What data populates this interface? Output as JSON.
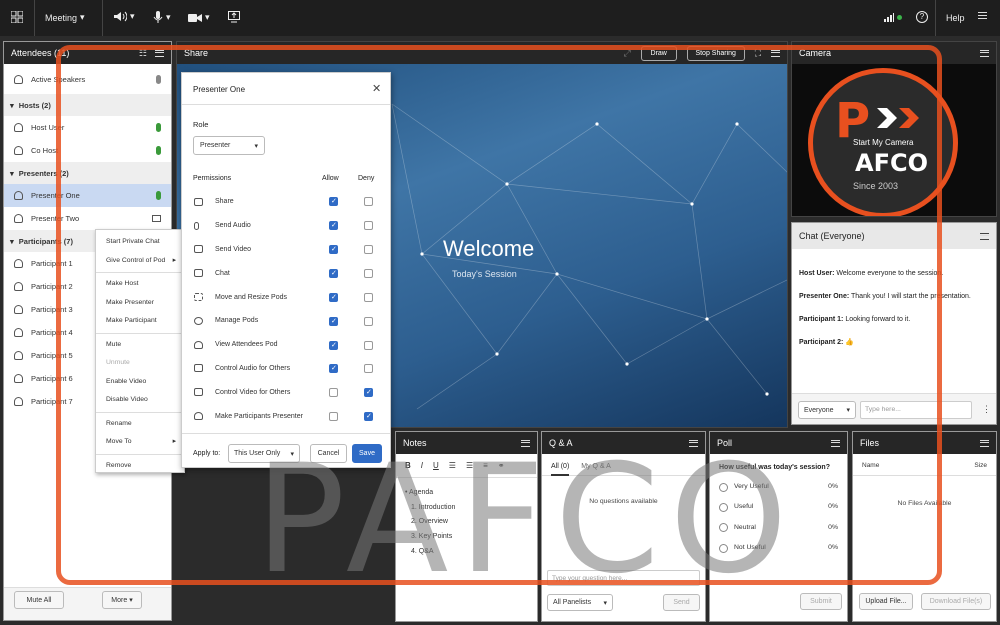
{
  "topbar": {
    "meeting": "Meeting",
    "help": "Help"
  },
  "attendees": {
    "title": "Attendees",
    "count": "(11)",
    "active_speakers": "Active Speakers",
    "hosts_header": "Hosts (2)",
    "hosts": [
      "Host User",
      "Co Host"
    ],
    "presenters_header": "Presenters (2)",
    "presenters": [
      "Presenter One",
      "Presenter Two"
    ],
    "participants_header": "Participants (7)",
    "participants": [
      "Participant 1",
      "Participant 2",
      "Participant 3",
      "Participant 4",
      "Participant 5",
      "Participant 6",
      "Participant 7"
    ],
    "mute_all": "Mute All",
    "more": "More"
  },
  "context_menu": [
    "Start Private Chat",
    "Give Control of Pod",
    "Make Host",
    "Make Presenter",
    "Make Participant",
    "Mute",
    "Unmute",
    "Enable Video",
    "Disable Video",
    "Rename",
    "Move To",
    "Remove"
  ],
  "share": {
    "title": "Share",
    "draw": "Draw",
    "stop": "Stop Sharing",
    "welcome": "Welcome",
    "session": "Today's Session"
  },
  "dialog": {
    "title": "Presenter One",
    "role_label": "Role",
    "role_value": "Presenter",
    "permissions_label": "Permissions",
    "allow": "Allow",
    "deny": "Deny",
    "perms": [
      "Share",
      "Send Audio",
      "Send Video",
      "Chat",
      "Move and Resize Pods",
      "Manage Pods",
      "View Attendees Pod",
      "Control Audio for Others",
      "Control Video for Others",
      "Make Participants Presenter"
    ],
    "apply_to_label": "Apply to:",
    "apply_to_value": "This User Only",
    "cancel": "Cancel",
    "save": "Save"
  },
  "camera": {
    "title": "Camera",
    "start": "Start My Camera",
    "logo_text": "AFCO",
    "since": "Since 2003"
  },
  "chat": {
    "title": "Chat",
    "scope": "(Everyone)",
    "messages": [
      {
        "who": "Host User:",
        "text": "Welcome everyone to the session."
      },
      {
        "who": "Presenter One:",
        "text": "Thank you! I will start the presentation."
      },
      {
        "who": "Participant 1:",
        "text": "Looking forward to it."
      },
      {
        "who": "Participant 2:",
        "text": "👍"
      }
    ],
    "audience": "Everyone",
    "placeholder": "Type here..."
  },
  "notes": {
    "title": "Notes",
    "toolbar": [
      "B",
      "I",
      "U"
    ],
    "agenda": "Agenda",
    "items": [
      "1. Introduction",
      "2. Overview",
      "3. Key Points",
      "4. Q&A"
    ]
  },
  "qa": {
    "title": "Q & A",
    "tab_all": "All (0)",
    "tab_my": "My Q & A",
    "empty": "No questions available",
    "placeholder": "Type your question here...",
    "audience": "All Panelists",
    "send": "Send"
  },
  "poll": {
    "title": "Poll",
    "question": "How useful was today's session?",
    "options": [
      "Very Useful",
      "Useful",
      "Neutral",
      "Not Useful"
    ],
    "percents": [
      "0%",
      "0%",
      "0%",
      "0%"
    ],
    "submit": "Submit"
  },
  "files": {
    "title": "Files",
    "col_name": "Name",
    "col_size": "Size",
    "empty": "No Files Available",
    "upload": "Upload File...",
    "download": "Download File(s)"
  },
  "watermark": "PAFCO"
}
